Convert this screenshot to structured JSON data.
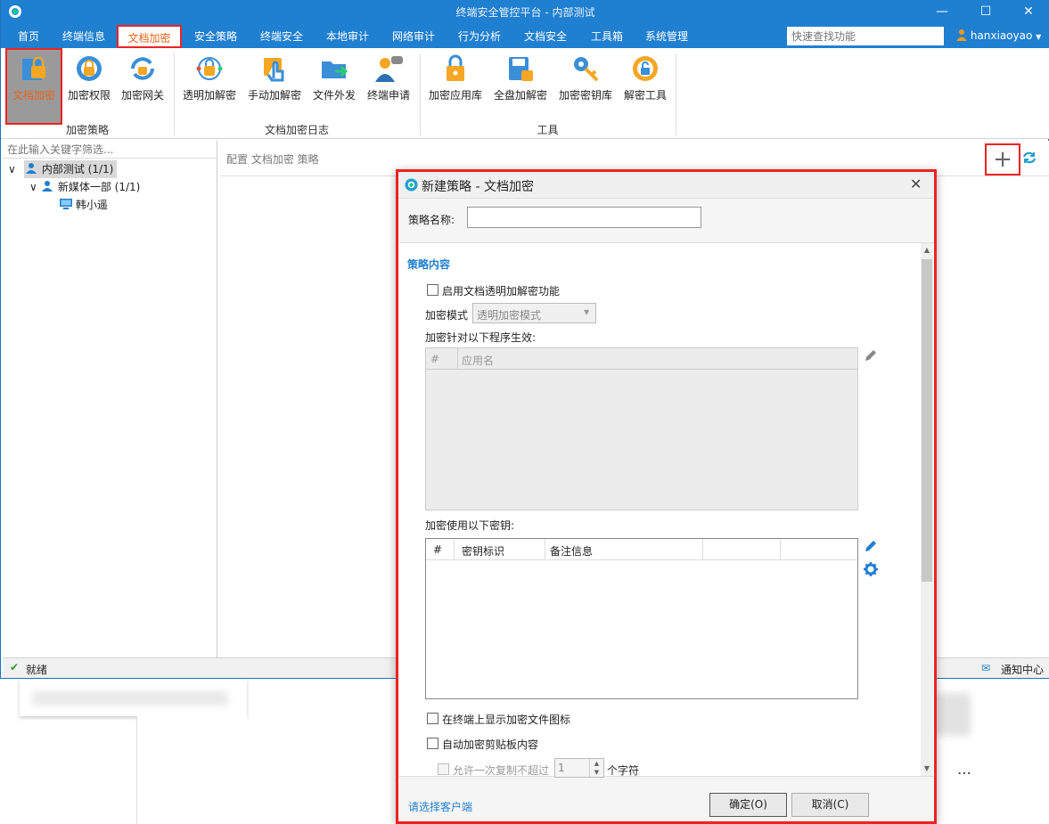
{
  "window": {
    "title": "终端安全管控平台 - 内部测试"
  },
  "menu": {
    "items": [
      "首页",
      "终端信息",
      "文档加密",
      "安全策略",
      "终端安全",
      "本地审计",
      "网络审计",
      "行为分析",
      "文档安全",
      "工具箱",
      "系统管理"
    ],
    "search_placeholder": "快速查找功能",
    "user": "hanxiaoyao"
  },
  "ribbon": {
    "buttons": [
      "文档加密",
      "加密权限",
      "加密网关",
      "透明加解密",
      "手动加解密",
      "文件外发",
      "终端申请",
      "加密应用库",
      "全盘加解密",
      "加密密钥库",
      "解密工具"
    ],
    "groups": [
      "加密策略",
      "文档加密日志",
      "工具"
    ]
  },
  "tree": {
    "filter_placeholder": "在此输入关键字筛选...",
    "nodes": [
      "内部测试 (1/1)",
      "新媒体一部 (1/1)",
      "韩小遥"
    ]
  },
  "main": {
    "breadcrumb": "配置 文档加密 策略"
  },
  "status": {
    "text": "就绪",
    "notify": "通知中心"
  },
  "dialog": {
    "title": "新建策略 - 文档加密",
    "name_label": "策略名称:",
    "section": "策略内容",
    "enable_label": "启用文档透明加解密功能",
    "mode_label": "加密模式",
    "mode_value": "透明加密模式",
    "programs_label": "加密针对以下程序生效:",
    "programs_cols": [
      "#",
      "应用名"
    ],
    "keys_label": "加密使用以下密钥:",
    "keys_cols": [
      "#",
      "密钥标识",
      "备注信息"
    ],
    "show_icon_label": "在终端上显示加密文件图标",
    "clipboard_label": "自动加密剪贴板内容",
    "copy_label_pre": "允许一次复制不超过",
    "copy_value": "1",
    "copy_label_post": "个字符",
    "client_link": "请选择客户端",
    "ok": "确定(O)",
    "cancel": "取消(C)"
  },
  "colors": {
    "accent": "#1f7fd1",
    "highlight": "#e22222",
    "active_text": "#e8641b"
  }
}
